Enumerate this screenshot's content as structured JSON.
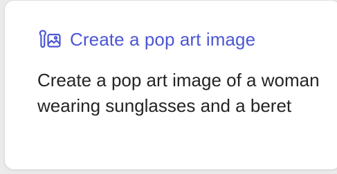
{
  "card": {
    "title": "Create a pop art image",
    "description": "Create a pop art image of a woman wearing sunglasses and a beret",
    "icon": "image-prompt-icon",
    "accent_color": "#4b56d2",
    "text_color": "#242424"
  }
}
